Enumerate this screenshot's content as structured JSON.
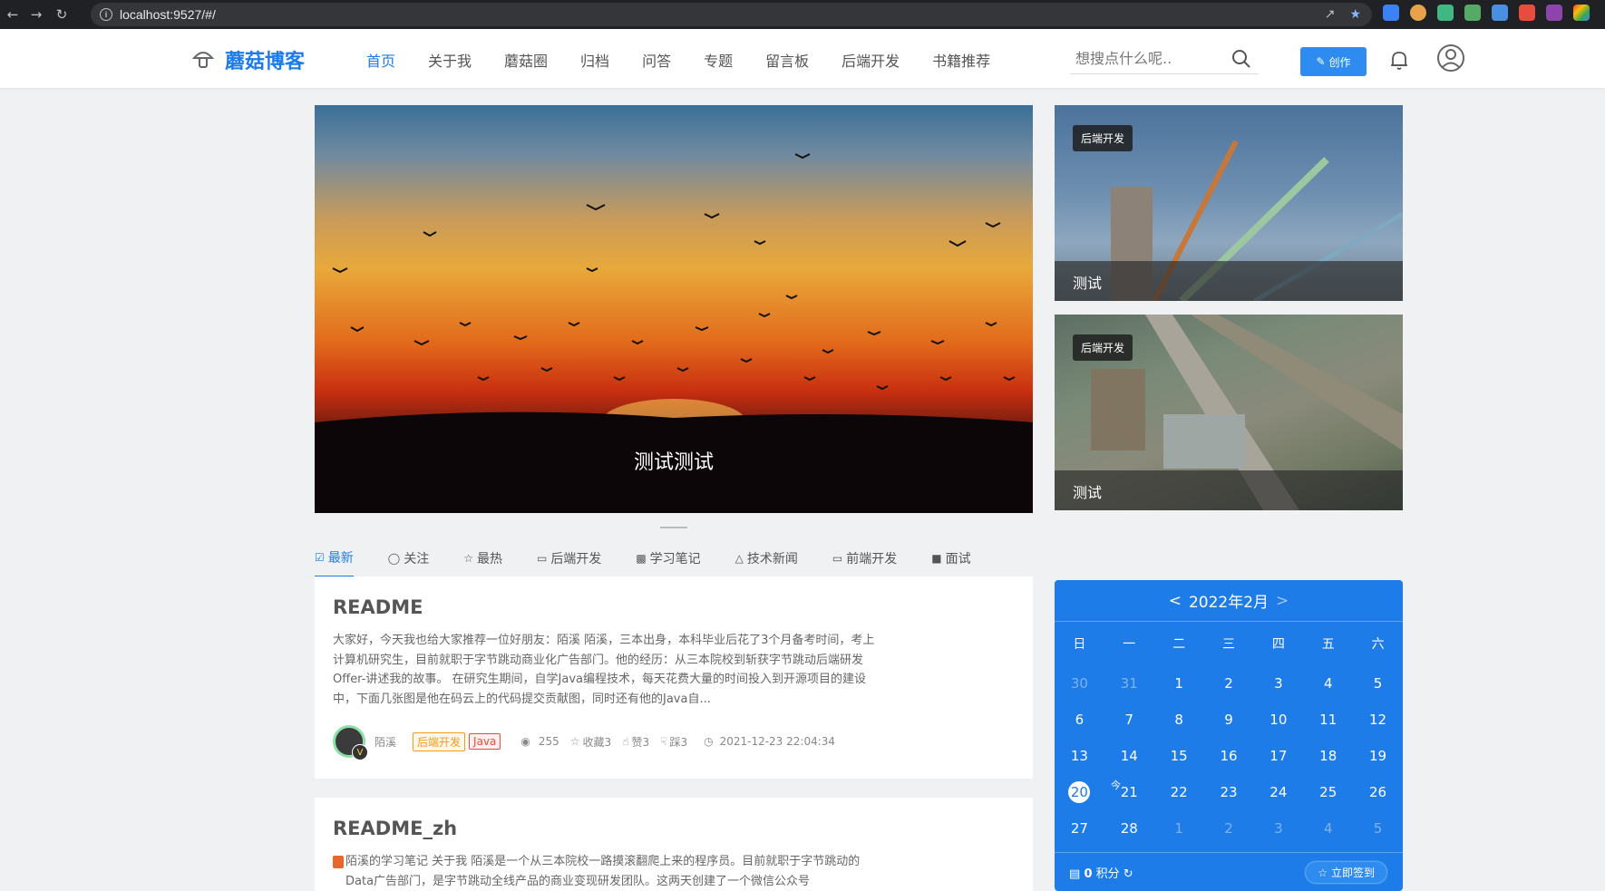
{
  "browser": {
    "url": "localhost:9527/#/"
  },
  "site": {
    "logo": "蘑菇博客",
    "nav": [
      "首页",
      "关于我",
      "蘑菇圈",
      "归档",
      "问答",
      "专题",
      "留言板",
      "后端开发",
      "书籍推荐"
    ],
    "search_placeholder": "想搜点什么呢..",
    "create_label": "创作"
  },
  "hero": {
    "title": "测试测试",
    "side": [
      {
        "tag": "后端开发",
        "caption": "测试"
      },
      {
        "tag": "后端开发",
        "caption": "测试"
      }
    ]
  },
  "tabs": [
    "最新",
    "关注",
    "最热",
    "后端开发",
    "学习笔记",
    "技术新闻",
    "前端开发",
    "面试"
  ],
  "articles": [
    {
      "title": "README",
      "summary": "大家好，今天我也给大家推荐一位好朋友：陌溪 陌溪，三本出身，本科毕业后花了3个月备考时间，考上计算机研究生，目前就职于字节跳动商业化广告部门。他的经历：从三本院校到斩获字节跳动后端研发Offer-讲述我的故事。 在研究生期间，自学Java编程技术，每天花费大量的时间投入到开源项目的建设中，下面几张图是他在码云上的代码提交贡献图，同时还有他的Java自...",
      "author": "陌溪",
      "tags": [
        "后端开发",
        "Java"
      ],
      "views": "255",
      "collect": "收藏3",
      "like": "赞3",
      "dislike": "踩3",
      "time": "2021-12-23 22:04:34"
    },
    {
      "title": "README_zh",
      "summary": "陌溪的学习笔记 关于我 陌溪是一个从三本院校一路摸滚翻爬上来的程序员。目前就职于字节跳动的Data广告部门，是字节跳动全线产品的商业变现研发团队。这两天创建了一个微信公众号"
    }
  ],
  "calendar": {
    "title": "2022年2月",
    "prev": "<",
    "next": ">",
    "weekdays": [
      "日",
      "一",
      "二",
      "三",
      "四",
      "五",
      "六"
    ],
    "today_mark": "今",
    "points": "0",
    "points_label": "积分",
    "checkin_label": "立即签到"
  }
}
